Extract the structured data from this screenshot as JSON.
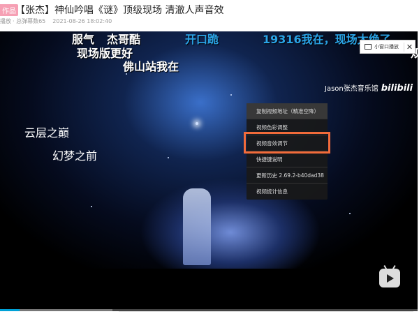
{
  "header": {
    "tag": "作品",
    "title": "【张杰】神仙吟唱《谜》顶级现场 清澈人声音效",
    "meta_views": "播放",
    "meta_danmaku": "· 总弹幕数65",
    "meta_date": "2021-08-26 18:02:40"
  },
  "danmaku": [
    "服气",
    "杰哥酷",
    "现场版更好",
    "佛山站我在",
    "开口跪",
    "19316我在，现场太绝了",
    "规"
  ],
  "captions": [
    "云层之巅",
    "幻梦之前"
  ],
  "mini_player": {
    "label": "小窗口播放",
    "close": "✕"
  },
  "watermark": {
    "text": "Jason张杰音乐馆",
    "logo": "bilibili"
  },
  "context_menu": [
    {
      "label": "复制视频地址（精准空降）"
    },
    {
      "label": "视频色彩调整"
    },
    {
      "label": "视频音效调节",
      "highlighted": true
    },
    {
      "label": "快捷键说明"
    },
    {
      "label": "更新历史 2.69.2-b40dad38"
    },
    {
      "label": "视频统计信息"
    }
  ],
  "progress": {
    "played_fraction": 0.047,
    "buffered_fraction": 0.27
  },
  "colors": {
    "accent": "#00a1d6",
    "highlight": "#f26b3a",
    "danmaku_blue": "#2aa3e6"
  }
}
